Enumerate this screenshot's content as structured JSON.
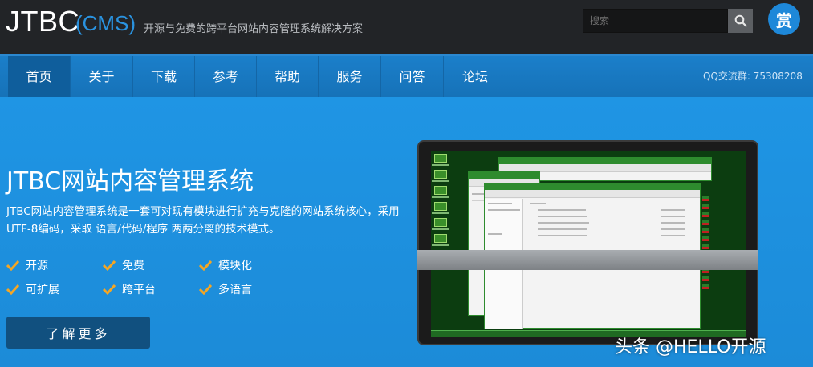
{
  "header": {
    "logo": "JTBC",
    "logo_suffix": "(CMS)",
    "tagline": "开源与免费的跨平台网站内容管理系统解决方案",
    "search_placeholder": "搜索",
    "reward_label": "赏"
  },
  "nav": {
    "items": [
      "首页",
      "关于",
      "下载",
      "参考",
      "帮助",
      "服务",
      "问答",
      "论坛"
    ],
    "active_index": 0,
    "qq_group": "QQ交流群: 75308208"
  },
  "hero": {
    "title": "JTBC网站内容管理系统",
    "description": "JTBC网站内容管理系统是一套可对现有模块进行扩充与克隆的网站系统核心，采用UTF-8编码，采取 语言/代码/程序 两两分离的技术模式。",
    "features": [
      "开源",
      "免费",
      "模块化",
      "可扩展",
      "跨平台",
      "多语言"
    ],
    "button_label": "了解更多"
  },
  "watermark": "头条 @HELLO开源",
  "colors": {
    "topbar": "#222427",
    "nav": "#1b7fca",
    "hero": "#1e90df",
    "accent_check": "#f5a623",
    "screen_bg": "#0c3d10"
  }
}
